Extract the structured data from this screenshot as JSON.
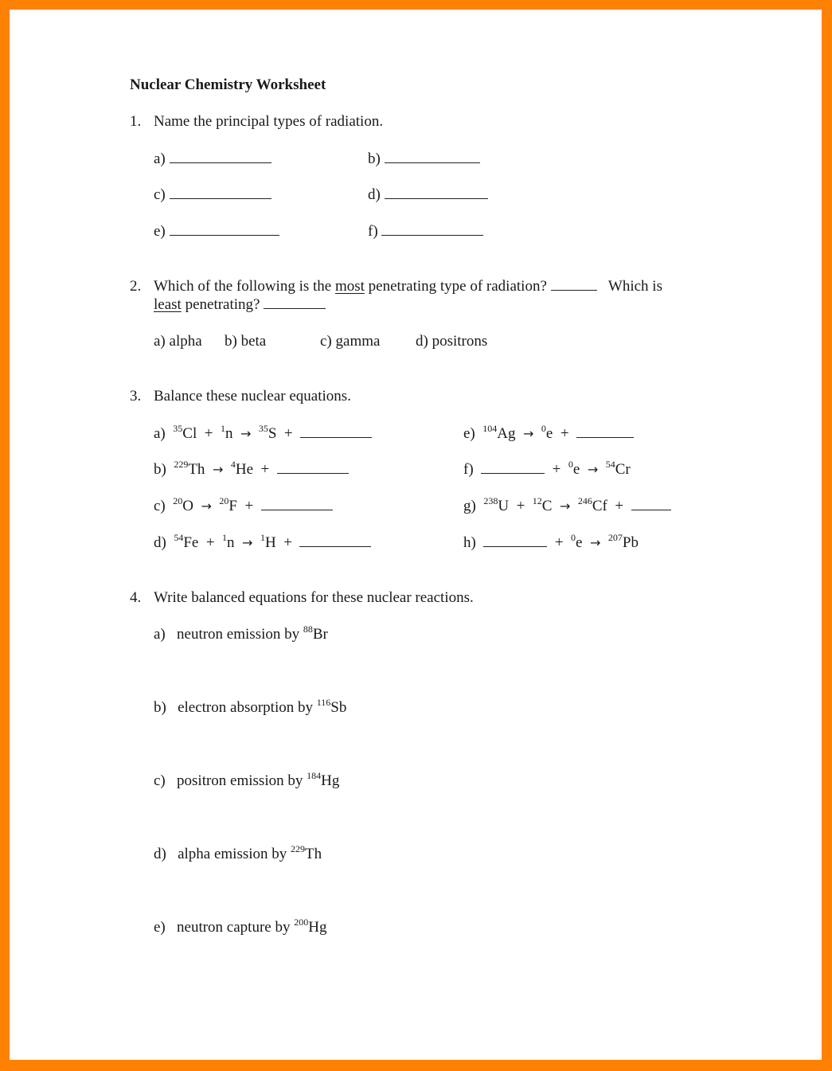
{
  "document": {
    "title": "Nuclear Chemistry Worksheet",
    "border_color": "#ff8104",
    "questions": [
      {
        "number": "1.",
        "prompt": "Name the principal types of radiation.",
        "answers": [
          {
            "label": "a)",
            "value": ""
          },
          {
            "label": "b)",
            "value": ""
          },
          {
            "label": "c)",
            "value": ""
          },
          {
            "label": "d)",
            "value": ""
          },
          {
            "label": "e)",
            "value": ""
          },
          {
            "label": "f)",
            "value": ""
          }
        ]
      },
      {
        "number": "2.",
        "prompt_part1": "Which of the following is the ",
        "emph1": "most",
        "prompt_part2": " penetrating type of radiation?",
        "prompt_part3": "Which is",
        "emph2": "least",
        "prompt_part4": " penetrating?",
        "options": [
          "a) alpha",
          "b) beta",
          "c) gamma",
          "d) positrons"
        ]
      },
      {
        "number": "3.",
        "prompt": "Balance these nuclear equations.",
        "equations": [
          {
            "label": "a)",
            "terms": [
              {
                "mass": "35",
                "sym": "Cl"
              },
              {
                "op": "+"
              },
              {
                "mass": "1",
                "sym": "n"
              },
              {
                "op": "arrow"
              },
              {
                "mass": "35",
                "sym": "S"
              },
              {
                "op": "+"
              },
              {
                "blank": true
              }
            ]
          },
          {
            "label": "b)",
            "terms": [
              {
                "mass": "229",
                "sym": "Th"
              },
              {
                "op": "arrow"
              },
              {
                "mass": "4",
                "sym": "He"
              },
              {
                "op": "+"
              },
              {
                "blank": true
              }
            ]
          },
          {
            "label": "c)",
            "terms": [
              {
                "mass": "20",
                "sym": "O"
              },
              {
                "op": "arrow"
              },
              {
                "mass": "20",
                "sym": "F"
              },
              {
                "op": "+"
              },
              {
                "blank": true
              }
            ]
          },
          {
            "label": "d)",
            "terms": [
              {
                "mass": "54",
                "sym": "Fe"
              },
              {
                "op": "+"
              },
              {
                "mass": "1",
                "sym": "n"
              },
              {
                "op": "arrow"
              },
              {
                "mass": "1",
                "sym": "H"
              },
              {
                "op": "+"
              },
              {
                "blank": true
              }
            ]
          },
          {
            "label": "e)",
            "terms": [
              {
                "mass": "104",
                "sym": "Ag"
              },
              {
                "op": "arrow"
              },
              {
                "mass": "0",
                "sym": "e"
              },
              {
                "op": "+"
              },
              {
                "blank": true
              }
            ]
          },
          {
            "label": "f)",
            "terms": [
              {
                "blank": true
              },
              {
                "op": "+"
              },
              {
                "mass": "0",
                "sym": "e"
              },
              {
                "op": "arrow"
              },
              {
                "mass": "54",
                "sym": "Cr"
              }
            ]
          },
          {
            "label": "g)",
            "terms": [
              {
                "mass": "238",
                "sym": "U"
              },
              {
                "op": "+"
              },
              {
                "mass": "12",
                "sym": "C"
              },
              {
                "op": "arrow"
              },
              {
                "mass": "246",
                "sym": "Cf"
              },
              {
                "op": "+"
              },
              {
                "blank": true
              }
            ]
          },
          {
            "label": "h)",
            "terms": [
              {
                "blank": true
              },
              {
                "op": "+"
              },
              {
                "mass": "0",
                "sym": "e"
              },
              {
                "op": "arrow"
              },
              {
                "mass": "207",
                "sym": "Pb"
              }
            ]
          }
        ]
      },
      {
        "number": "4.",
        "prompt": "Write balanced equations for these nuclear reactions.",
        "items": [
          {
            "label": "a)",
            "text": "neutron emission by ",
            "mass": "88",
            "sym": "Br"
          },
          {
            "label": "b)",
            "text": "electron absorption by ",
            "mass": "116",
            "sym": "Sb"
          },
          {
            "label": "c)",
            "text": "positron emission by ",
            "mass": "184",
            "sym": "Hg"
          },
          {
            "label": "d)",
            "text": "alpha emission by ",
            "mass": "229",
            "sym": "Th"
          },
          {
            "label": "e)",
            "text": "neutron capture by ",
            "mass": "200",
            "sym": "Hg"
          }
        ]
      }
    ]
  }
}
